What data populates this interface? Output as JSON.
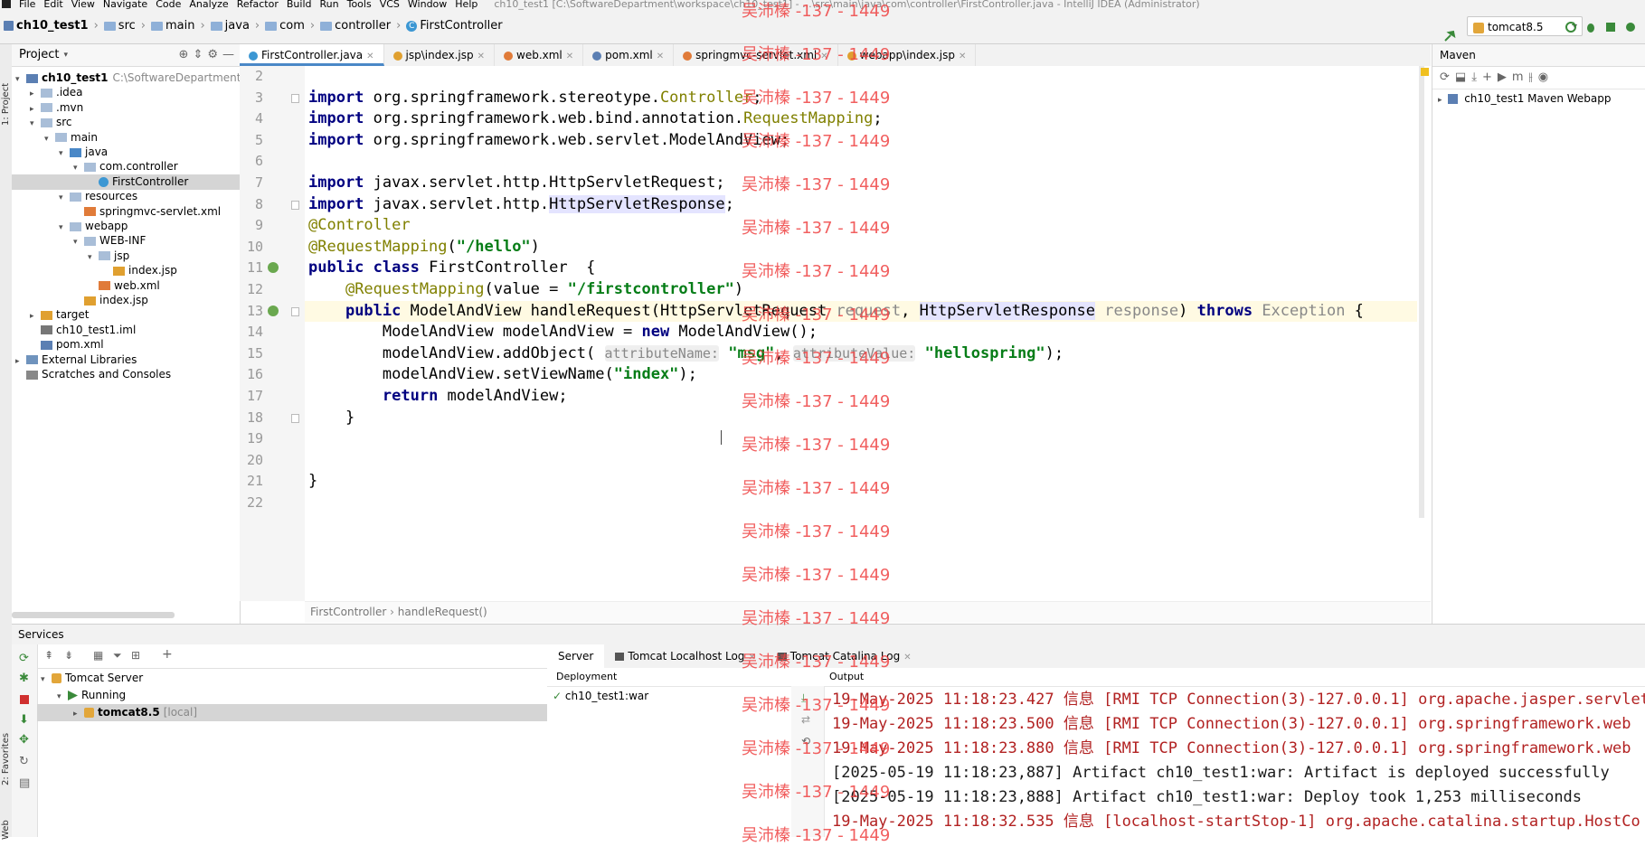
{
  "menu": {
    "items": [
      "File",
      "Edit",
      "View",
      "Navigate",
      "Code",
      "Analyze",
      "Refactor",
      "Build",
      "Run",
      "Tools",
      "VCS",
      "Window",
      "Help"
    ],
    "window_title": "ch10_test1 [C:\\SoftwareDepartment\\workspace\\ch10_test1] - ...\\src\\main\\java\\com\\controller\\FirstController.java - IntelliJ IDEA (Administrator)"
  },
  "breadcrumbs": [
    "ch10_test1",
    "src",
    "main",
    "java",
    "com",
    "controller",
    "FirstController"
  ],
  "run_config": {
    "label": "tomcat8.5"
  },
  "project_panel": {
    "title": "Project",
    "tree": [
      {
        "label": "ch10_test1",
        "extra": "C:\\SoftwareDepartment\\w",
        "depth": 0,
        "arrow": "▾",
        "icon": "module",
        "bold": true
      },
      {
        "label": ".idea",
        "depth": 1,
        "arrow": "▸",
        "icon": "folder"
      },
      {
        "label": ".mvn",
        "depth": 1,
        "arrow": "▸",
        "icon": "folder"
      },
      {
        "label": "src",
        "depth": 1,
        "arrow": "▾",
        "icon": "folder"
      },
      {
        "label": "main",
        "depth": 2,
        "arrow": "▾",
        "icon": "folder"
      },
      {
        "label": "java",
        "depth": 3,
        "arrow": "▾",
        "icon": "folder-blue"
      },
      {
        "label": "com.controller",
        "depth": 4,
        "arrow": "▾",
        "icon": "package"
      },
      {
        "label": "FirstController",
        "depth": 5,
        "arrow": "",
        "icon": "class",
        "selected": true
      },
      {
        "label": "resources",
        "depth": 3,
        "arrow": "▾",
        "icon": "folder"
      },
      {
        "label": "springmvc-servlet.xml",
        "depth": 4,
        "arrow": "",
        "icon": "xml"
      },
      {
        "label": "webapp",
        "depth": 3,
        "arrow": "▾",
        "icon": "folder"
      },
      {
        "label": "WEB-INF",
        "depth": 4,
        "arrow": "▾",
        "icon": "folder"
      },
      {
        "label": "jsp",
        "depth": 5,
        "arrow": "▾",
        "icon": "folder"
      },
      {
        "label": "index.jsp",
        "depth": 6,
        "arrow": "",
        "icon": "jsp"
      },
      {
        "label": "web.xml",
        "depth": 5,
        "arrow": "",
        "icon": "xml"
      },
      {
        "label": "index.jsp",
        "depth": 4,
        "arrow": "",
        "icon": "jsp"
      },
      {
        "label": "target",
        "depth": 1,
        "arrow": "▸",
        "icon": "folder-orange",
        "target": true
      },
      {
        "label": "ch10_test1.iml",
        "depth": 1,
        "arrow": "",
        "icon": "iml"
      },
      {
        "label": "pom.xml",
        "depth": 1,
        "arrow": "",
        "icon": "maven"
      },
      {
        "label": "External Libraries",
        "depth": 0,
        "arrow": "▸",
        "icon": "lib"
      },
      {
        "label": "Scratches and Consoles",
        "depth": 0,
        "arrow": "",
        "icon": "scratch"
      }
    ]
  },
  "editor_tabs": [
    {
      "label": "FirstController.java",
      "active": true
    },
    {
      "label": "jsp\\index.jsp"
    },
    {
      "label": "web.xml"
    },
    {
      "label": "pom.xml"
    },
    {
      "label": "springmvc-servlet.xml"
    },
    {
      "label": "webapp\\index.jsp"
    }
  ],
  "code": {
    "line_numbers": [
      "2",
      "3",
      "4",
      "5",
      "6",
      "7",
      "8",
      "9",
      "10",
      "11",
      "12",
      "13",
      "14",
      "15",
      "16",
      "17",
      "18",
      "19",
      "20",
      "21",
      "22"
    ],
    "lines": [
      [],
      [
        {
          "t": "import ",
          "c": "kw"
        },
        {
          "t": "org.springframework.stereotype."
        },
        {
          "t": "Controller",
          "c": "cls"
        },
        {
          "t": ";"
        }
      ],
      [
        {
          "t": "import ",
          "c": "kw"
        },
        {
          "t": "org.springframework.web.bind.annotation."
        },
        {
          "t": "RequestMapping",
          "c": "cls"
        },
        {
          "t": ";"
        }
      ],
      [
        {
          "t": "import ",
          "c": "kw"
        },
        {
          "t": "org.springframework.web.servlet.ModelAndView;"
        }
      ],
      [],
      [
        {
          "t": "import ",
          "c": "kw"
        },
        {
          "t": "javax.servlet.http.HttpServletRequest;"
        }
      ],
      [
        {
          "t": "import ",
          "c": "kw"
        },
        {
          "t": "javax.servlet.http."
        },
        {
          "t": "HttpServletResponse",
          "c": "hl"
        },
        {
          "t": ";"
        }
      ],
      [
        {
          "t": "@Controller",
          "c": "ann"
        }
      ],
      [
        {
          "t": "@RequestMapping",
          "c": "ann"
        },
        {
          "t": "("
        },
        {
          "t": "\"/hello\"",
          "c": "str"
        },
        {
          "t": ")"
        }
      ],
      [
        {
          "t": "public ",
          "c": "kw"
        },
        {
          "t": "class ",
          "c": "kw"
        },
        {
          "t": "FirstController  {"
        }
      ],
      [
        {
          "t": "    "
        },
        {
          "t": "@RequestMapping",
          "c": "ann"
        },
        {
          "t": "(value = "
        },
        {
          "t": "\"/firstcontroller\"",
          "c": "str"
        },
        {
          "t": ")"
        }
      ],
      [
        {
          "t": "    "
        },
        {
          "t": "public ",
          "c": "kw"
        },
        {
          "t": "ModelAndView handleRequest(HttpServletRequest "
        },
        {
          "t": "request",
          "c": "param"
        },
        {
          "t": ", "
        },
        {
          "t": "HttpServletResponse",
          "c": "hl"
        },
        {
          "t": " "
        },
        {
          "t": "response",
          "c": "param"
        },
        {
          "t": ") "
        },
        {
          "t": "throws ",
          "c": "kw"
        },
        {
          "t": "Exception",
          "c": "param"
        },
        {
          "t": " {"
        }
      ],
      [
        {
          "t": "        ModelAndView modelAndView = "
        },
        {
          "t": "new ",
          "c": "kw"
        },
        {
          "t": "ModelAndView();"
        }
      ],
      [
        {
          "t": "        modelAndView.addObject( "
        },
        {
          "t": "attributeName:",
          "c": "hint"
        },
        {
          "t": " "
        },
        {
          "t": "\"msg\"",
          "c": "str"
        },
        {
          "t": ", "
        },
        {
          "t": "attributeValue:",
          "c": "hint"
        },
        {
          "t": " "
        },
        {
          "t": "\"hellospring\"",
          "c": "str"
        },
        {
          "t": ");"
        }
      ],
      [
        {
          "t": "        modelAndView.setViewName("
        },
        {
          "t": "\"index\"",
          "c": "str"
        },
        {
          "t": ");"
        }
      ],
      [
        {
          "t": "        "
        },
        {
          "t": "return ",
          "c": "kw"
        },
        {
          "t": "modelAndView;"
        }
      ],
      [
        {
          "t": "    }"
        }
      ],
      [],
      [],
      [
        {
          "t": "}"
        }
      ],
      []
    ]
  },
  "editor_breadcrumb": [
    "FirstController",
    "handleRequest()"
  ],
  "maven": {
    "title": "Maven",
    "project": "ch10_test1 Maven Webapp"
  },
  "services": {
    "title": "Services",
    "tree": [
      {
        "label": "Tomcat Server",
        "depth": 0,
        "arrow": "▾"
      },
      {
        "label": "Running",
        "depth": 1,
        "arrow": "▾"
      },
      {
        "label": "tomcat8.5",
        "extra": "[local]",
        "depth": 2,
        "arrow": "▸",
        "selected": true
      }
    ],
    "tabs": [
      {
        "label": "Server",
        "active": true
      },
      {
        "label": "Tomcat Localhost Log"
      },
      {
        "label": "Tomcat Catalina Log"
      }
    ],
    "deployment_header": "Deployment",
    "deployment_item": "ch10_test1:war",
    "output_header": "Output",
    "output_lines": [
      {
        "text": "19-May-2025 11:18:23.427 信息 [RMI TCP Connection(3)-127.0.0.1] org.apache.jasper.servlet",
        "type": "err"
      },
      {
        "text": "19-May-2025 11:18:23.500 信息 [RMI TCP Connection(3)-127.0.0.1] org.springframework.web",
        "type": "err"
      },
      {
        "text": "19-May-2025 11:18:23.880 信息 [RMI TCP Connection(3)-127.0.0.1] org.springframework.web",
        "type": "err"
      },
      {
        "text": "[2025-05-19 11:18:23,887] Artifact ch10_test1:war: Artifact is deployed successfully",
        "type": "info"
      },
      {
        "text": "[2025-05-19 11:18:23,888] Artifact ch10_test1:war: Deploy took 1,253 milliseconds",
        "type": "info"
      },
      {
        "text": "19-May-2025 11:18:32.535 信息 [localhost-startStop-1] org.apache.catalina.startup.HostCo",
        "type": "err"
      }
    ]
  },
  "left_strip": {
    "top": "1: Project",
    "favorites": "2: Favorites",
    "web": "Web"
  },
  "watermark": {
    "text": "吴沛榛 -137 - 1449"
  },
  "colors": {
    "accent": "#4a88c7",
    "selection": "#d5d5d5",
    "keyword": "#000080",
    "string": "#067d17",
    "annotation": "#808000",
    "error_output": "#b22222",
    "watermark": "#ef4444"
  }
}
